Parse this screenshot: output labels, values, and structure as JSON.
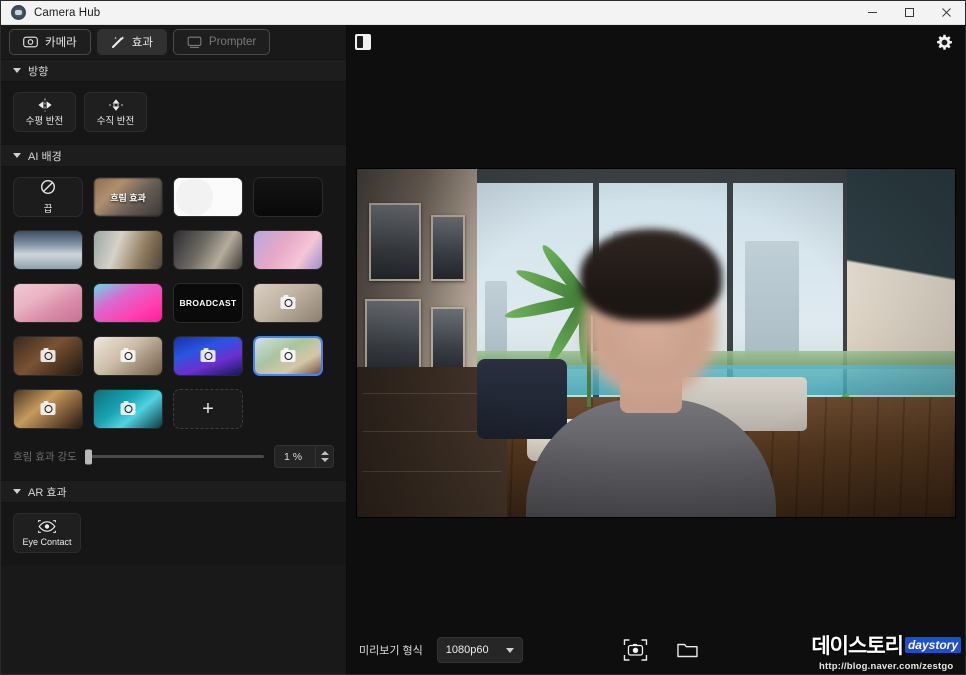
{
  "window": {
    "title": "Camera Hub",
    "app_icon": "camera-hub-icon",
    "minimize": "─",
    "maximize": "□",
    "close": "✕"
  },
  "tabs": [
    {
      "label": "카메라",
      "icon": "camera-icon",
      "state": "bordered"
    },
    {
      "label": "효과",
      "icon": "magic-wand-icon",
      "state": "active"
    },
    {
      "label": "Prompter",
      "icon": "prompter-icon",
      "state": "disabled"
    }
  ],
  "sections": {
    "orientation": {
      "title": "방향",
      "buttons": [
        {
          "label": "수평 반전",
          "icon": "flip-horizontal-icon"
        },
        {
          "label": "수직 반전",
          "icon": "flip-vertical-icon"
        }
      ]
    },
    "ai_background": {
      "title": "AI 배경",
      "items": [
        {
          "name": "off",
          "label": "끕",
          "kind": "off"
        },
        {
          "name": "blur",
          "label": "흐림 효과",
          "kind": "blur"
        },
        {
          "name": "white",
          "label": "",
          "kind": "solid-white"
        },
        {
          "name": "black",
          "label": "",
          "kind": "solid-black"
        },
        {
          "name": "office-blue",
          "label": "",
          "kind": "photo"
        },
        {
          "name": "living-room-warm",
          "label": "",
          "kind": "photo"
        },
        {
          "name": "home-office",
          "label": "",
          "kind": "photo"
        },
        {
          "name": "pink-abstract",
          "label": "",
          "kind": "photo"
        },
        {
          "name": "pastel-lounge",
          "label": "",
          "kind": "photo"
        },
        {
          "name": "neon-pink-sofa",
          "label": "",
          "kind": "photo"
        },
        {
          "name": "nvidia-broadcast",
          "label": "BROADCAST",
          "kind": "logo"
        },
        {
          "name": "beige-bedroom",
          "label": "",
          "kind": "photo-cam"
        },
        {
          "name": "dark-lounge",
          "label": "",
          "kind": "photo-cam"
        },
        {
          "name": "bright-studio",
          "label": "",
          "kind": "photo-cam"
        },
        {
          "name": "blue-stage",
          "label": "",
          "kind": "photo-cam"
        },
        {
          "name": "sunny-office",
          "label": "",
          "kind": "photo-cam",
          "selected": true
        },
        {
          "name": "warm-room",
          "label": "",
          "kind": "photo-cam"
        },
        {
          "name": "teal-studio",
          "label": "",
          "kind": "photo-cam"
        }
      ],
      "add_label": "+",
      "slider": {
        "label": "흐림 효과 강도",
        "value": "1 %",
        "percent": 1
      }
    },
    "ar_effects": {
      "title": "AR 효과",
      "buttons": [
        {
          "label": "Eye Contact",
          "icon": "eye-icon"
        }
      ]
    }
  },
  "preview": {
    "panel_toggle_icon": "panel-toggle-icon",
    "settings_icon": "gear-icon",
    "format_label": "미리보기 형식",
    "format_value": "1080p60",
    "snapshot_icon": "camera-capture-icon",
    "folder_icon": "folder-icon"
  },
  "watermark": {
    "title": "데이스토리",
    "badge": "daystory",
    "url": "http://blog.naver.com/zestgo"
  },
  "colors": {
    "accent": "#4a7dff",
    "sidebar_bg": "#191919",
    "panel_bg": "#161616",
    "titlebar_bg": "#f3f3f3"
  }
}
